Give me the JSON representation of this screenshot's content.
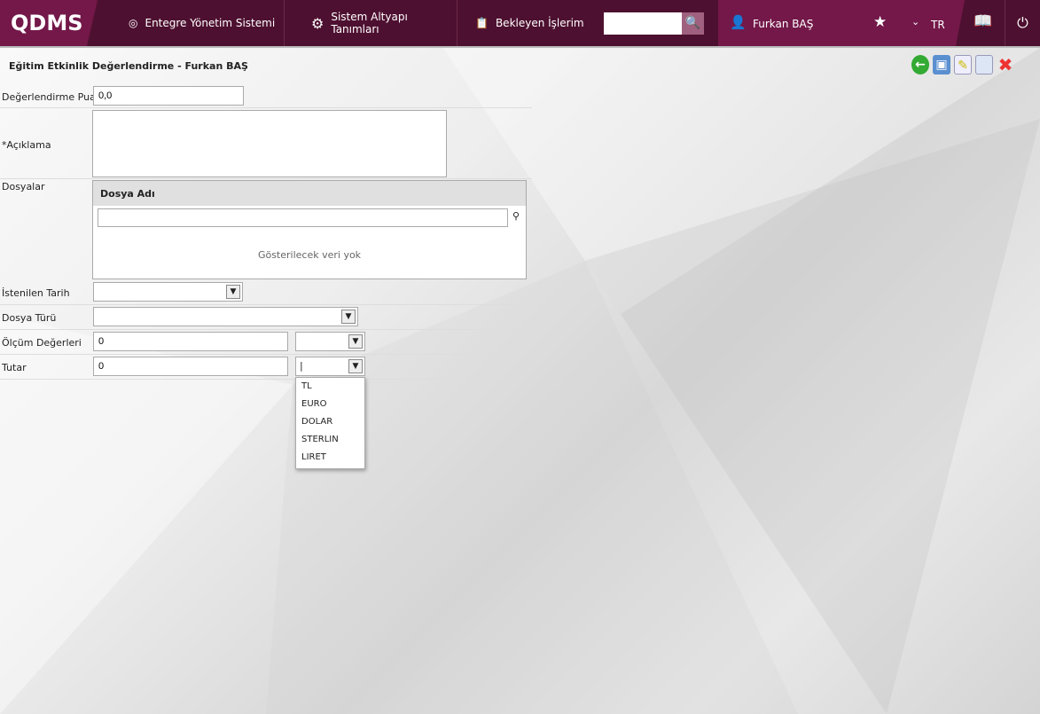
{
  "header": {
    "logo": "QDMS",
    "nav": [
      "Entegre Yönetim Sistemi",
      "Sistem Altyapı Tanımları",
      "Bekleyen İşlerim"
    ],
    "search_value": "",
    "user": "Furkan BAŞ",
    "lang": "TR"
  },
  "page": {
    "title": "Eğitim Etkinlik Değerlendirme - Furkan BAŞ"
  },
  "form": {
    "score_label": "Değerlendirme Puanı",
    "score_value": "0,0",
    "desc_label": "*Açıklama",
    "files_label": "Dosyalar",
    "file_col": "Dosya Adı",
    "empty": "Gösterilecek veri yok",
    "date_label": "İstenilen Tarih",
    "type_label": "Dosya Türü",
    "measure_label": "Ölçüm Değerleri",
    "measure_value": "0",
    "amount_label": "Tutar",
    "amount_value": "0"
  },
  "currency_options": [
    "TL",
    "EURO",
    "DOLAR",
    "STERLIN",
    "LIRET"
  ]
}
